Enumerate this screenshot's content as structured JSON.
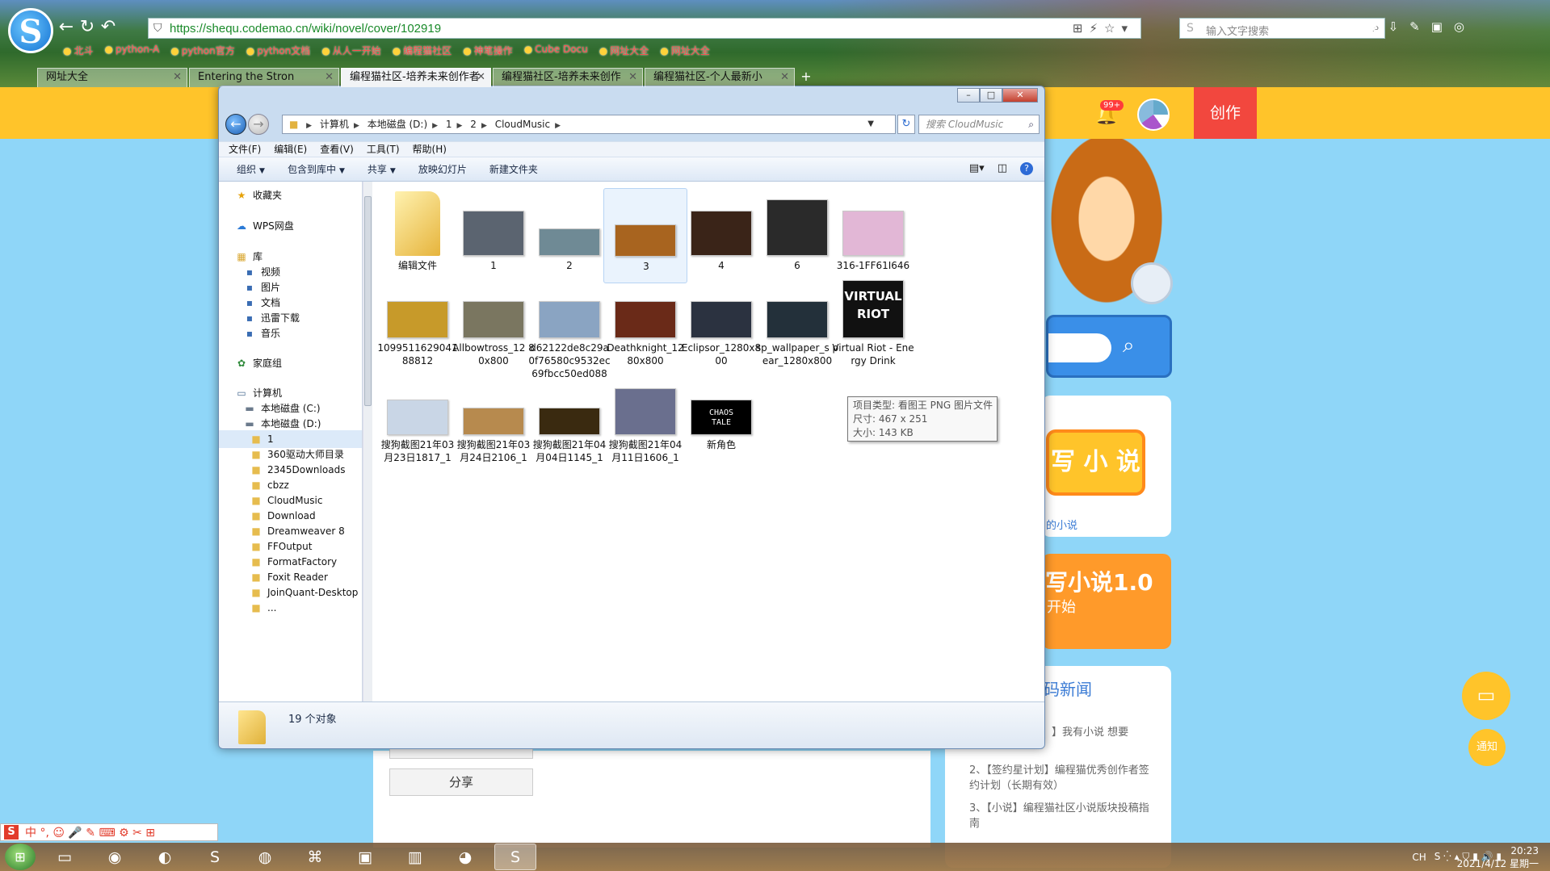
{
  "browser": {
    "url": "https://shequ.codemao.cn/wiki/novel/cover/102919",
    "search_placeholder": "输入文字搜索",
    "bookmarks": [
      "北斗",
      "python-A",
      "python官方",
      "python文档",
      "从人一开始",
      "编程猫社区",
      "神笔操作",
      "Cube Docu",
      "网址大全",
      "网址大全"
    ],
    "tabs": [
      {
        "label": "网址大全",
        "active": false
      },
      {
        "label": "Entering the Stron",
        "active": false
      },
      {
        "label": "编程猫社区-培养未来创作者",
        "active": true
      },
      {
        "label": "编程猫社区-培养未来创作",
        "active": false
      },
      {
        "label": "编程猫社区-个人最新小",
        "active": false
      }
    ]
  },
  "site": {
    "create_label": "创作",
    "badge": "99+",
    "write_novel": "写 小 说",
    "my_novel_link": "的小说",
    "banner_title": "写小说1.0",
    "banner_sub": "开始",
    "news_title": "码新闻",
    "news": [
      "】我有小说 想要",
      "2、【签约星计划】编程猫优秀创作者签约计划（长期有效）",
      "3、【小说】编程猫社区小说版块投稿指南"
    ],
    "share_label": "分享",
    "notice_label": "通知"
  },
  "explorer": {
    "address": [
      "计算机",
      "本地磁盘 (D:)",
      "1",
      "2",
      "CloudMusic"
    ],
    "search_placeholder": "搜索 CloudMusic",
    "menu": [
      "文件(F)",
      "编辑(E)",
      "查看(V)",
      "工具(T)",
      "帮助(H)"
    ],
    "commands": [
      "组织",
      "包含到库中",
      "共享",
      "放映幻灯片",
      "新建文件夹"
    ],
    "nav": {
      "favorites": "收藏夹",
      "wps": "WPS网盘",
      "libraries": "库",
      "lib_items": [
        "视频",
        "图片",
        "文档",
        "迅雷下载",
        "音乐"
      ],
      "homegroup": "家庭组",
      "computer": "计算机",
      "drive_c": "本地磁盘 (C:)",
      "drive_d": "本地磁盘 (D:)",
      "folders": [
        "1",
        "360驱动大师目录",
        "2345Downloads",
        "cbzz",
        "CloudMusic",
        "Download",
        "Dreamweaver 8",
        "FFOutput",
        "FormatFactory",
        "Foxit Reader",
        "JoinQuant-Desktop",
        "..."
      ]
    },
    "items": [
      {
        "label": "编辑文件",
        "kind": "folder"
      },
      {
        "label": "1",
        "kind": "image",
        "color": "#5b6470"
      },
      {
        "label": "2",
        "kind": "image",
        "color": "#6f8a95"
      },
      {
        "label": "3",
        "kind": "image",
        "color": "#a8641f"
      },
      {
        "label": "4",
        "kind": "image",
        "color": "#3a2418"
      },
      {
        "label": "6",
        "kind": "image",
        "color": "#2a2a2a"
      },
      {
        "label": "316-1FF61I646",
        "kind": "image",
        "color": "#e2b7d6"
      },
      {
        "label": "1099511629041 88812",
        "kind": "image",
        "color": "#c79a2a"
      },
      {
        "label": "Allbowtross_12 80x800",
        "kind": "image",
        "color": "#7a7660"
      },
      {
        "label": "d62122de8c29a 0f76580c9532ec 69fbcc50ed088",
        "kind": "image",
        "color": "#8aa4c2"
      },
      {
        "label": "Deathknight_12 80x800",
        "kind": "image",
        "color": "#6a2a18"
      },
      {
        "label": "Eclipsor_1280x8 00",
        "kind": "image",
        "color": "#2b3240"
      },
      {
        "label": "sp_wallpaper_s pear_1280x800",
        "kind": "image",
        "color": "#23303a"
      },
      {
        "label": "Virtual Riot - Energy Drink",
        "kind": "image",
        "color": "#111111"
      },
      {
        "label": "搜狗截图21年03 月23日1817_1",
        "kind": "image",
        "color": "#c9d6e6"
      },
      {
        "label": "搜狗截图21年03 月24日2106_1",
        "kind": "image",
        "color": "#b78a4e"
      },
      {
        "label": "搜狗截图21年04 月04日1145_1",
        "kind": "image",
        "color": "#3a2a10"
      },
      {
        "label": "搜狗截图21年04 月11日1606_1",
        "kind": "image",
        "color": "#6a6f8e"
      },
      {
        "label": "新角色",
        "kind": "image",
        "color": "#000000"
      }
    ],
    "tooltip": [
      "项目类型: 看图王 PNG 图片文件",
      "尺寸: 467 x 251",
      "大小: 143 KB"
    ],
    "object_count": "19 个对象"
  },
  "taskbar": {
    "tray_text": "CH",
    "time": "20:23",
    "date": "2021/4/12 星期一"
  },
  "thumbs_text": {
    "chaos": "CHAOS TALE",
    "riot": "VIRTUAL RIOT"
  }
}
